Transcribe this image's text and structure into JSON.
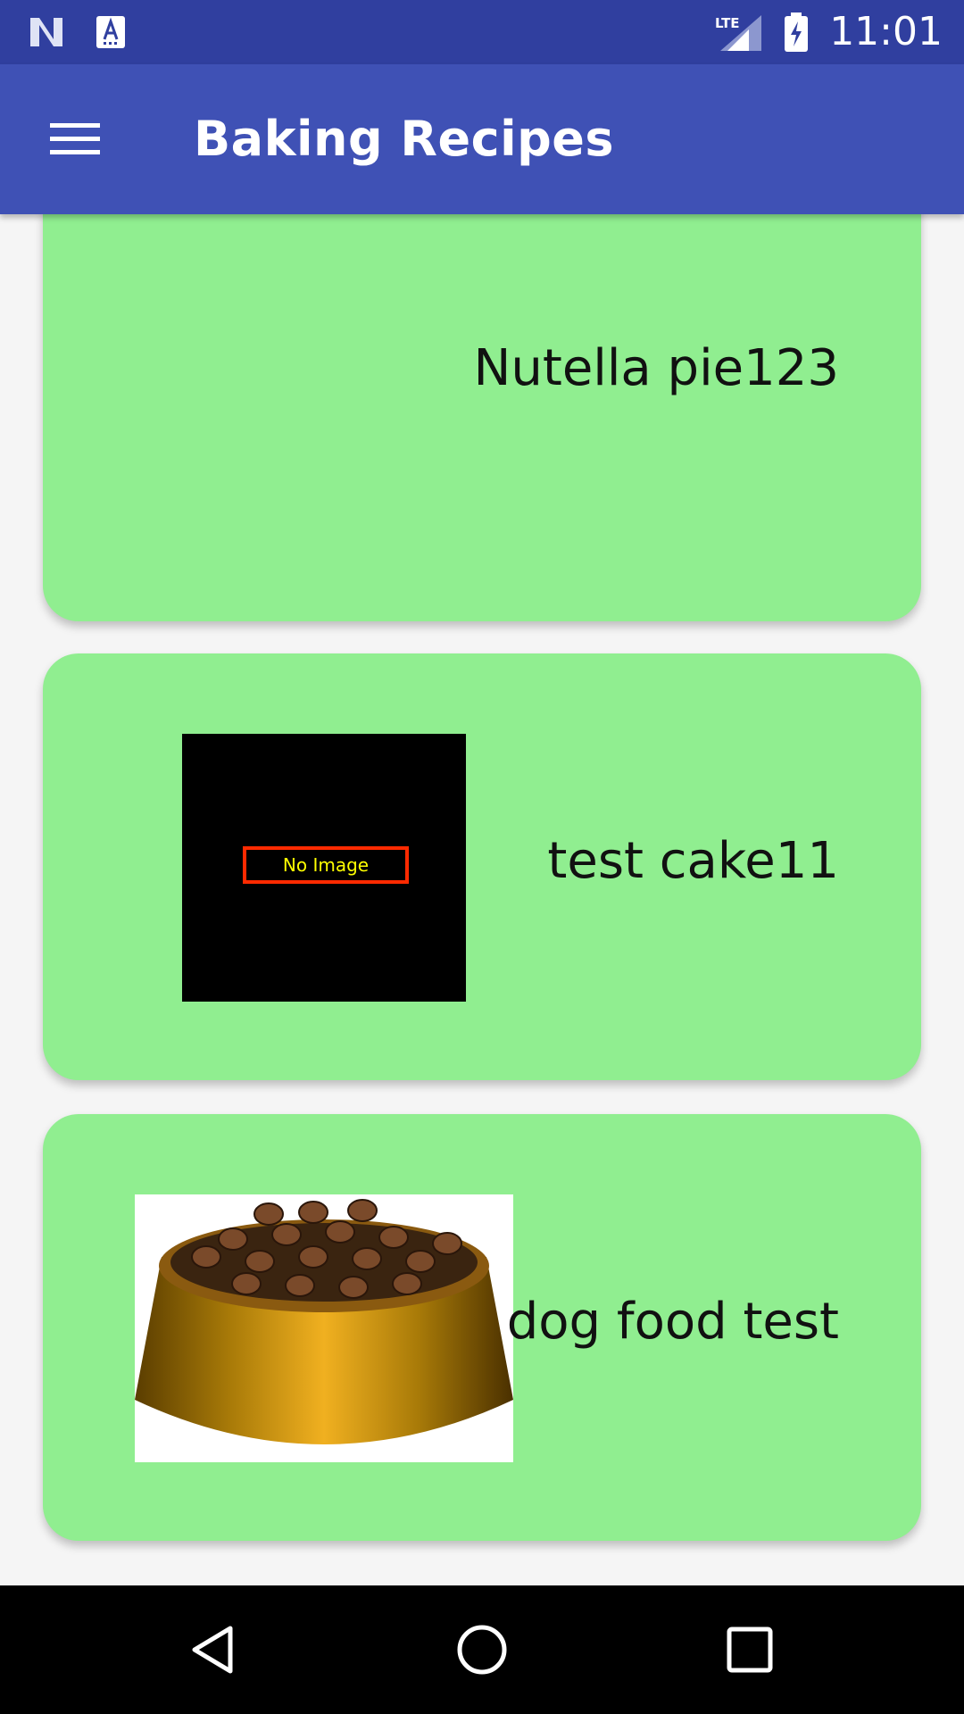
{
  "status_bar": {
    "time": "11:01",
    "left_icons": [
      "notification-n-icon",
      "keyboard-a-icon"
    ],
    "right_icons": [
      "lte-signal-icon",
      "battery-charging-icon"
    ],
    "lte_label": "LTE"
  },
  "toolbar": {
    "title": "Baking Recipes",
    "menu_icon": "hamburger-menu-icon"
  },
  "recipes": [
    {
      "title": "Nutella pie123",
      "image": "none"
    },
    {
      "title": "test cake11",
      "image": "placeholder",
      "placeholder_text": "No Image"
    },
    {
      "title": "dog food test",
      "image": "dog-food-bowl"
    }
  ],
  "nav_bar": {
    "buttons": [
      "back-icon",
      "home-icon",
      "recents-icon"
    ]
  },
  "colors": {
    "status_bar": "#303f9f",
    "toolbar": "#3f51b5",
    "card": "#90ee90",
    "background": "#f5f5f5"
  }
}
